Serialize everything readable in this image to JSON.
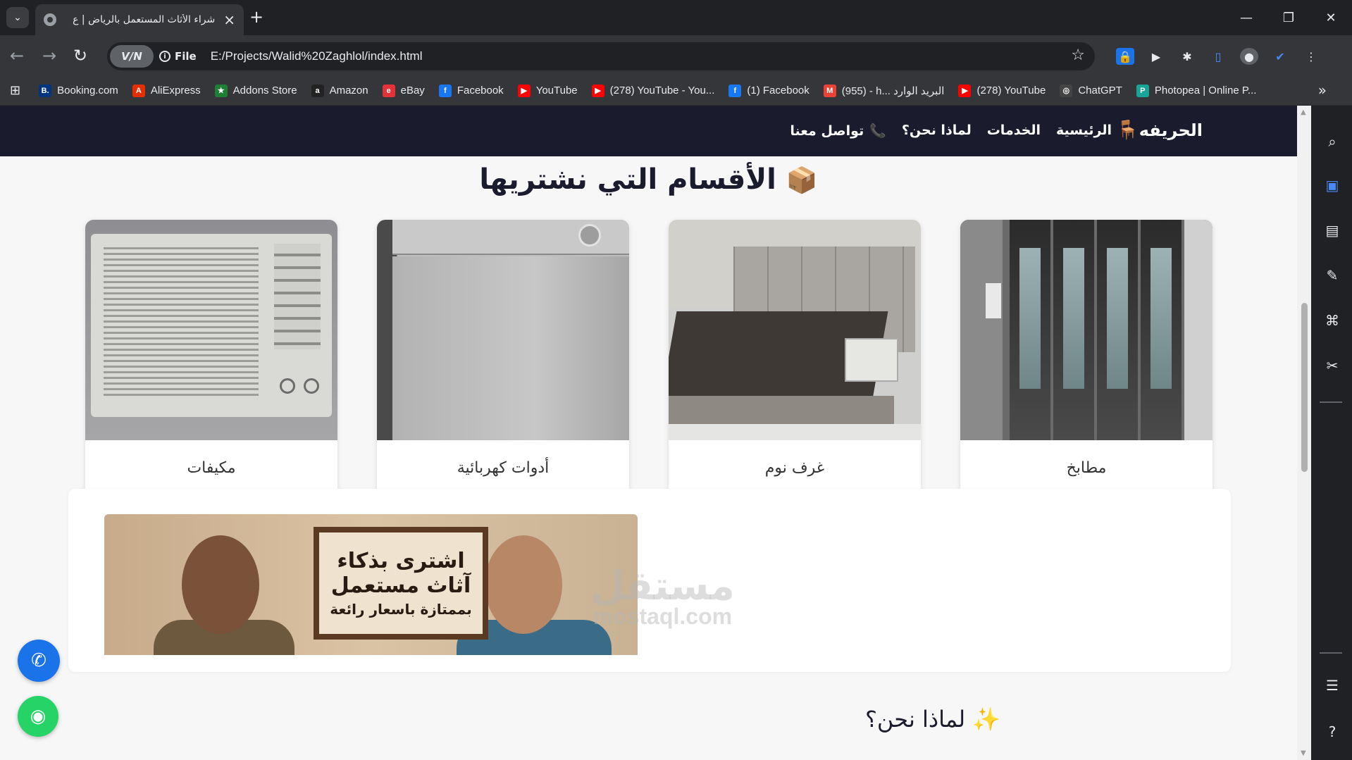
{
  "browser": {
    "tab_title": "شراء الأثاث المستعمل بالرياض | ع",
    "new_tab_symbol": "+",
    "vpn_label": "V/N",
    "file_label": "File",
    "url": "E:/Projects/Walid%20Zaghlol/index.html",
    "bookmarks": [
      {
        "label": "Booking.com",
        "icon": "B.",
        "color": "#003580"
      },
      {
        "label": "AliExpress",
        "icon": "A",
        "color": "#e62e04"
      },
      {
        "label": "Addons Store",
        "icon": "★",
        "color": "#1e7e34"
      },
      {
        "label": "Amazon",
        "icon": "a",
        "color": "#222222"
      },
      {
        "label": "eBay",
        "icon": "e",
        "color": "#e53238"
      },
      {
        "label": "Facebook",
        "icon": "f",
        "color": "#1877f2"
      },
      {
        "label": "YouTube",
        "icon": "▶",
        "color": "#ff0000"
      },
      {
        "label": "(278) YouTube - You...",
        "icon": "▶",
        "color": "#ff0000"
      },
      {
        "label": "(1) Facebook",
        "icon": "f",
        "color": "#1877f2"
      },
      {
        "label": "(955) - h... البريد الوارد",
        "icon": "M",
        "color": "#ea4335"
      },
      {
        "label": "(278) YouTube",
        "icon": "▶",
        "color": "#ff0000"
      },
      {
        "label": "ChatGPT",
        "icon": "◎",
        "color": "#444444"
      },
      {
        "label": "Photopea | Online P...",
        "icon": "P",
        "color": "#18a497"
      }
    ]
  },
  "site": {
    "nav": {
      "brand": "الحريفه",
      "links": [
        "الرئيسية",
        "الخدمات",
        "لماذا نحن؟",
        "تواصل معنا"
      ]
    },
    "categories_title": "الأقسام التي نشتريها",
    "categories": [
      {
        "label": "مطابخ",
        "image": "kitchen"
      },
      {
        "label": "غرف نوم",
        "image": "bedroom"
      },
      {
        "label": "أدوات كهربائية",
        "image": "dishwasher"
      },
      {
        "label": "مكيفات",
        "image": "air-conditioner"
      }
    ],
    "promo_image": {
      "line1": "اشترى بذكاء",
      "line2": "آثاث مستعمل",
      "line3": "بممتازة باسعار رائعة"
    },
    "watermark": {
      "arabic": "مستقل",
      "latin": "mostaql.com"
    },
    "why_us_title": "لماذا نحن؟",
    "fabs": [
      "phone-icon",
      "whatsapp-icon"
    ]
  }
}
